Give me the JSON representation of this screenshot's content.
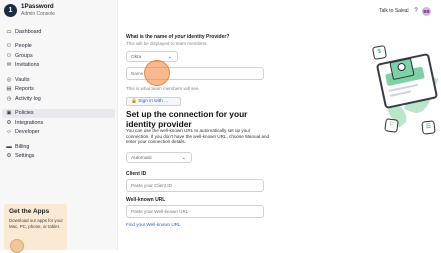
{
  "app": {
    "name": "1Password",
    "subtitle": "Admin Console",
    "logo_glyph": "1"
  },
  "sidebar": {
    "groups": [
      [
        {
          "label": "Dashboard",
          "icon": "dashboard-icon",
          "glyph": "▭"
        }
      ],
      [
        {
          "label": "People",
          "icon": "person-icon",
          "glyph": "⚇"
        },
        {
          "label": "Groups",
          "icon": "groups-icon",
          "glyph": "⚇"
        },
        {
          "label": "Invitations",
          "icon": "invitations-icon",
          "glyph": "✉"
        }
      ],
      [
        {
          "label": "Vaults",
          "icon": "vault-icon",
          "glyph": "◎"
        },
        {
          "label": "Reports",
          "icon": "reports-icon",
          "glyph": "▤"
        },
        {
          "label": "Activity log",
          "icon": "activity-icon",
          "glyph": "◷"
        }
      ],
      [
        {
          "label": "Policies",
          "icon": "policies-icon",
          "glyph": "▣",
          "active": true
        },
        {
          "label": "Integrations",
          "icon": "integrations-icon",
          "glyph": "⚙"
        },
        {
          "label": "Developer",
          "icon": "developer-icon",
          "glyph": "‹›"
        }
      ],
      [
        {
          "label": "Billing",
          "icon": "billing-icon",
          "glyph": "▬"
        },
        {
          "label": "Settings",
          "icon": "settings-icon",
          "glyph": "⚙"
        }
      ]
    ],
    "promo": {
      "title": "Get the Apps",
      "body": "Download our apps for your Mac, PC, phone, or tablet."
    }
  },
  "header": {
    "talk_to_sales": "Talk to Sales",
    "avatar_initials": "BB"
  },
  "main": {
    "question": "What is the name of",
    "question_em": "your",
    "question_tail": "identity Provider?",
    "question_sub": "This will be displayed to team members.",
    "provider_select_value": "Okta",
    "name_placeholder": "Name",
    "name_hint": "This is what team members will see.",
    "signin_button": "🔒 Sign in with ...",
    "section_title": "Set up the connection for your identity provider",
    "section_desc": "You can use the well-known URL to automatically set up your connection. If you don't have the well-known URL, choose Manual and enter your connection details.",
    "method_select_value": "Automatic",
    "client_id_label": "Client ID",
    "client_id_placeholder": "Paste your Client ID",
    "well_known_label": "Well-known URL",
    "well_known_placeholder": "Paste your Well-known URL",
    "find_link": "Find your Well-known URL"
  },
  "colors": {
    "accent": "#2c5dd6",
    "promo_bg": "#fbe9d4",
    "illustration_green": "#7ed1a4",
    "cursor_highlight": "#f08232"
  }
}
